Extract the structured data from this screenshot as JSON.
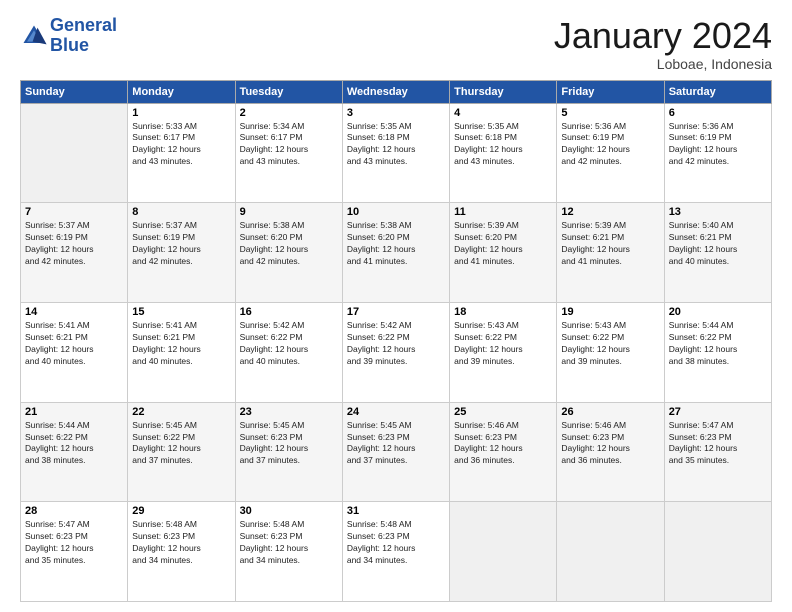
{
  "header": {
    "logo_line1": "General",
    "logo_line2": "Blue",
    "month": "January 2024",
    "location": "Loboae, Indonesia"
  },
  "weekdays": [
    "Sunday",
    "Monday",
    "Tuesday",
    "Wednesday",
    "Thursday",
    "Friday",
    "Saturday"
  ],
  "weeks": [
    [
      {
        "day": "",
        "sunrise": "",
        "sunset": "",
        "daylight": ""
      },
      {
        "day": "1",
        "sunrise": "5:33 AM",
        "sunset": "6:17 PM",
        "daylight": "12 hours and 43 minutes."
      },
      {
        "day": "2",
        "sunrise": "5:34 AM",
        "sunset": "6:17 PM",
        "daylight": "12 hours and 43 minutes."
      },
      {
        "day": "3",
        "sunrise": "5:35 AM",
        "sunset": "6:18 PM",
        "daylight": "12 hours and 43 minutes."
      },
      {
        "day": "4",
        "sunrise": "5:35 AM",
        "sunset": "6:18 PM",
        "daylight": "12 hours and 43 minutes."
      },
      {
        "day": "5",
        "sunrise": "5:36 AM",
        "sunset": "6:19 PM",
        "daylight": "12 hours and 42 minutes."
      },
      {
        "day": "6",
        "sunrise": "5:36 AM",
        "sunset": "6:19 PM",
        "daylight": "12 hours and 42 minutes."
      }
    ],
    [
      {
        "day": "7",
        "sunrise": "5:37 AM",
        "sunset": "6:19 PM",
        "daylight": "12 hours and 42 minutes."
      },
      {
        "day": "8",
        "sunrise": "5:37 AM",
        "sunset": "6:19 PM",
        "daylight": "12 hours and 42 minutes."
      },
      {
        "day": "9",
        "sunrise": "5:38 AM",
        "sunset": "6:20 PM",
        "daylight": "12 hours and 42 minutes."
      },
      {
        "day": "10",
        "sunrise": "5:38 AM",
        "sunset": "6:20 PM",
        "daylight": "12 hours and 41 minutes."
      },
      {
        "day": "11",
        "sunrise": "5:39 AM",
        "sunset": "6:20 PM",
        "daylight": "12 hours and 41 minutes."
      },
      {
        "day": "12",
        "sunrise": "5:39 AM",
        "sunset": "6:21 PM",
        "daylight": "12 hours and 41 minutes."
      },
      {
        "day": "13",
        "sunrise": "5:40 AM",
        "sunset": "6:21 PM",
        "daylight": "12 hours and 40 minutes."
      }
    ],
    [
      {
        "day": "14",
        "sunrise": "5:41 AM",
        "sunset": "6:21 PM",
        "daylight": "12 hours and 40 minutes."
      },
      {
        "day": "15",
        "sunrise": "5:41 AM",
        "sunset": "6:21 PM",
        "daylight": "12 hours and 40 minutes."
      },
      {
        "day": "16",
        "sunrise": "5:42 AM",
        "sunset": "6:22 PM",
        "daylight": "12 hours and 40 minutes."
      },
      {
        "day": "17",
        "sunrise": "5:42 AM",
        "sunset": "6:22 PM",
        "daylight": "12 hours and 39 minutes."
      },
      {
        "day": "18",
        "sunrise": "5:43 AM",
        "sunset": "6:22 PM",
        "daylight": "12 hours and 39 minutes."
      },
      {
        "day": "19",
        "sunrise": "5:43 AM",
        "sunset": "6:22 PM",
        "daylight": "12 hours and 39 minutes."
      },
      {
        "day": "20",
        "sunrise": "5:44 AM",
        "sunset": "6:22 PM",
        "daylight": "12 hours and 38 minutes."
      }
    ],
    [
      {
        "day": "21",
        "sunrise": "5:44 AM",
        "sunset": "6:22 PM",
        "daylight": "12 hours and 38 minutes."
      },
      {
        "day": "22",
        "sunrise": "5:45 AM",
        "sunset": "6:22 PM",
        "daylight": "12 hours and 37 minutes."
      },
      {
        "day": "23",
        "sunrise": "5:45 AM",
        "sunset": "6:23 PM",
        "daylight": "12 hours and 37 minutes."
      },
      {
        "day": "24",
        "sunrise": "5:45 AM",
        "sunset": "6:23 PM",
        "daylight": "12 hours and 37 minutes."
      },
      {
        "day": "25",
        "sunrise": "5:46 AM",
        "sunset": "6:23 PM",
        "daylight": "12 hours and 36 minutes."
      },
      {
        "day": "26",
        "sunrise": "5:46 AM",
        "sunset": "6:23 PM",
        "daylight": "12 hours and 36 minutes."
      },
      {
        "day": "27",
        "sunrise": "5:47 AM",
        "sunset": "6:23 PM",
        "daylight": "12 hours and 35 minutes."
      }
    ],
    [
      {
        "day": "28",
        "sunrise": "5:47 AM",
        "sunset": "6:23 PM",
        "daylight": "12 hours and 35 minutes."
      },
      {
        "day": "29",
        "sunrise": "5:48 AM",
        "sunset": "6:23 PM",
        "daylight": "12 hours and 34 minutes."
      },
      {
        "day": "30",
        "sunrise": "5:48 AM",
        "sunset": "6:23 PM",
        "daylight": "12 hours and 34 minutes."
      },
      {
        "day": "31",
        "sunrise": "5:48 AM",
        "sunset": "6:23 PM",
        "daylight": "12 hours and 34 minutes."
      },
      {
        "day": "",
        "sunrise": "",
        "sunset": "",
        "daylight": ""
      },
      {
        "day": "",
        "sunrise": "",
        "sunset": "",
        "daylight": ""
      },
      {
        "day": "",
        "sunrise": "",
        "sunset": "",
        "daylight": ""
      }
    ]
  ],
  "labels": {
    "sunrise_prefix": "Sunrise: ",
    "sunset_prefix": "Sunset: ",
    "daylight_prefix": "Daylight: "
  }
}
